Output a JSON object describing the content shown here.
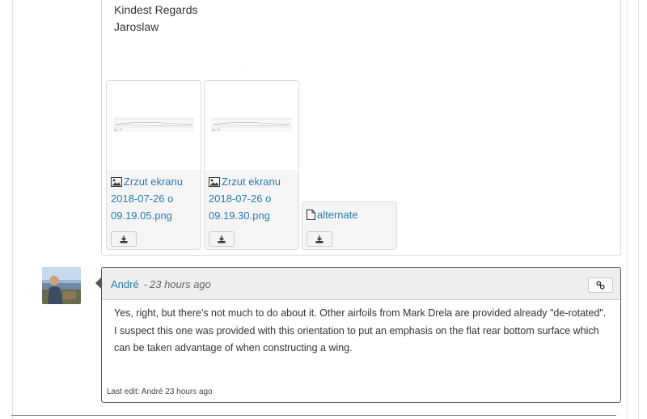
{
  "top_post": {
    "signoff_line1": "Kindest Regards",
    "signoff_line2": "Jaroslaw",
    "attachments": [
      {
        "name_line1": "Zrzut ekranu",
        "name_line2": "2018-07-26 o",
        "name_line3": "09.19.05.png",
        "icon": "image-icon"
      },
      {
        "name_line1": "Zrzut ekranu",
        "name_line2": "2018-07-26 o",
        "name_line3": "09.19.30.png",
        "icon": "image-icon"
      },
      {
        "name_line1": "alternate",
        "icon": "file-icon"
      }
    ],
    "download_icon": "download-icon"
  },
  "reply_post": {
    "author": "André",
    "separator": "-",
    "time": "23 hours ago",
    "permalink_icon": "link-icon",
    "body": "Yes, right, but there's not much to do about it. Other airfoils from Mark Drela are provided already \"de-rotated\". I suspect this one was provided with this orientation to put an emphasis on the flat rear bottom surface which can be taken advantage of when constructing a wing.",
    "last_edit": "Last edit: André 23 hours ago"
  },
  "colors": {
    "link": "#2a7ab0",
    "header_bg": "#eeeeee",
    "border_dark": "#555555"
  }
}
